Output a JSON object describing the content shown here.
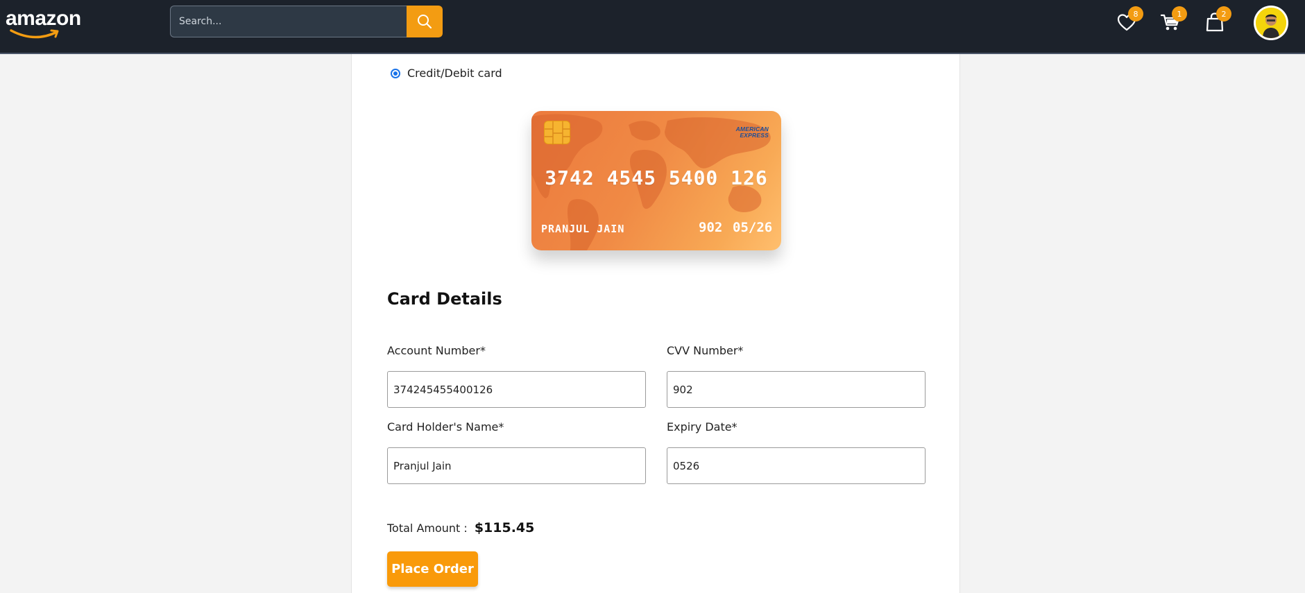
{
  "header": {
    "logo_text": "amazon",
    "search": {
      "placeholder": "Search...",
      "value": ""
    },
    "wishlist_count": "8",
    "cart_count": "1",
    "bag_count": "2",
    "icons": [
      "search-icon",
      "heart-icon",
      "cart-icon",
      "shopping-bag-icon",
      "avatar"
    ]
  },
  "payment": {
    "selected_option_label": "Credit/Debit card"
  },
  "card_preview": {
    "brand_line1": "AMERICAN",
    "brand_line2": "EXPRESS",
    "number": "3742 4545 5400 126",
    "holder": "PRANJUL JAIN",
    "cvv": "902",
    "expiry": "05/26"
  },
  "card_details": {
    "title": "Card Details",
    "account_number_label": "Account Number*",
    "account_number_value": "374245455400126",
    "cvv_label": "CVV Number*",
    "cvv_value": "902",
    "holder_label": "Card Holder's Name*",
    "holder_value": "Pranjul Jain",
    "expiry_label": "Expiry Date*",
    "expiry_value": "0526"
  },
  "order": {
    "total_label": "Total Amount :",
    "total_value": "$115.45",
    "place_order_label": "Place Order"
  },
  "colors": {
    "header_bg": "#1c222b",
    "accent": "#f39c12",
    "card_gradient_start": "#ec7a3d",
    "card_gradient_end": "#ffbf6e",
    "radio": "#1a73e8"
  }
}
